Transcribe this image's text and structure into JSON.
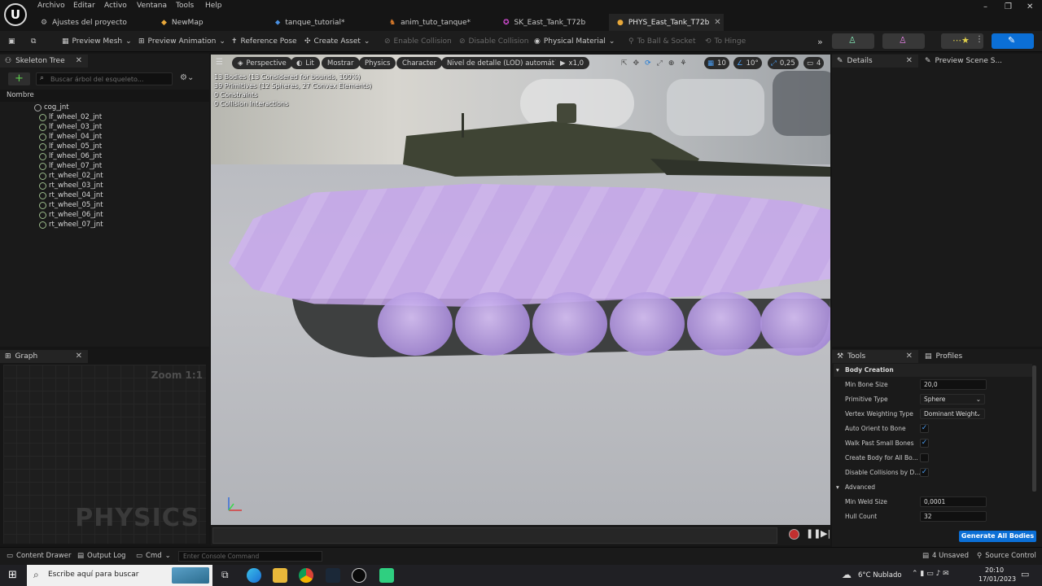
{
  "menu": {
    "items": [
      "Archivo",
      "Editar",
      "Activo",
      "Ventana",
      "Tools",
      "Help"
    ]
  },
  "tabs": [
    {
      "label": "Ajustes del proyecto",
      "icon": "settings-icon",
      "active": false
    },
    {
      "label": "NewMap",
      "icon": "map-icon",
      "active": false
    },
    {
      "label": "tanque_tutorial*",
      "icon": "blueprint-icon",
      "active": false
    },
    {
      "label": "anim_tuto_tanque*",
      "icon": "animation-icon",
      "active": false
    },
    {
      "label": "SK_East_Tank_T72b",
      "icon": "skeletal-mesh-icon",
      "active": false
    },
    {
      "label": "PHYS_East_Tank_T72b",
      "icon": "physics-asset-icon",
      "active": true
    }
  ],
  "toolbar": {
    "preview_mesh": "Preview Mesh",
    "preview_animation": "Preview Animation",
    "reference_pose": "Reference Pose",
    "create_asset": "Create Asset",
    "enable_collision": "Enable Collision",
    "disable_collision": "Disable Collision",
    "physical_material": "Physical Material",
    "to_ball_socket": "To Ball & Socket",
    "to_hinge": "To Hinge"
  },
  "skeleton_tree": {
    "title": "Skeleton Tree",
    "search_placeholder": "Buscar árbol del esqueleto...",
    "column_header": "Nombre",
    "root": "cog_jnt",
    "bones": [
      "lf_wheel_02_jnt",
      "lf_wheel_03_jnt",
      "lf_wheel_04_jnt",
      "lf_wheel_05_jnt",
      "lf_wheel_06_jnt",
      "lf_wheel_07_jnt",
      "rt_wheel_02_jnt",
      "rt_wheel_03_jnt",
      "rt_wheel_04_jnt",
      "rt_wheel_05_jnt",
      "rt_wheel_06_jnt",
      "rt_wheel_07_jnt"
    ]
  },
  "graph": {
    "title": "Graph",
    "zoom": "Zoom 1:1",
    "watermark": "PHYSICS"
  },
  "viewport": {
    "perspective": "Perspective",
    "lit": "Lit",
    "show": "Mostrar",
    "physics": "Physics",
    "character": "Character",
    "lod": "Nivel de detalle (LOD) automático",
    "play_rate": "x1,0",
    "grid_snap": "10",
    "rot_snap": "10°",
    "scale_snap": "0,25",
    "cam_speed": "4",
    "stats": [
      "13 Bodies (13 Considered for bounds, 100%)",
      "39 Primitives (12 Spheres, 27 Convex Elements)",
      "0 Constraints",
      "0 Collision Interactions"
    ]
  },
  "details": {
    "title": "Details",
    "preview_title": "Preview Scene S..."
  },
  "tools": {
    "title": "Tools",
    "profiles": "Profiles",
    "section_body": "Body Creation",
    "min_bone_size_label": "Min Bone Size",
    "min_bone_size": "20,0",
    "primitive_type_label": "Primitive Type",
    "primitive_type": "Sphere",
    "vertex_weighting_label": "Vertex Weighting Type",
    "vertex_weighting": "Dominant Weight",
    "auto_orient_label": "Auto Orient to Bone",
    "walk_past_label": "Walk Past Small Bones",
    "create_all_label": "Create Body for All Bo...",
    "disable_collisions_label": "Disable Collisions by D...",
    "section_advanced": "Advanced",
    "min_weld_label": "Min Weld Size",
    "min_weld": "0,0001",
    "hull_count_label": "Hull Count",
    "hull_count": "32",
    "generate_button": "Generate All Bodies",
    "checks": {
      "auto_orient": true,
      "walk_past": true,
      "create_all": false,
      "disable_collisions": true
    }
  },
  "status": {
    "content_drawer": "Content Drawer",
    "output_log": "Output Log",
    "cmd": "Cmd",
    "console_placeholder": "Enter Console Command",
    "unsaved": "4 Unsaved",
    "source_control": "Source Control"
  },
  "taskbar": {
    "search_placeholder": "Escribe aquí para buscar",
    "weather": "6°C  Nublado",
    "time": "20:10",
    "date": "17/01/2023"
  },
  "colors": {
    "accent": "#0b6fd6",
    "body_purple": "#c7a6ee",
    "panel": "#1a1a1a"
  }
}
